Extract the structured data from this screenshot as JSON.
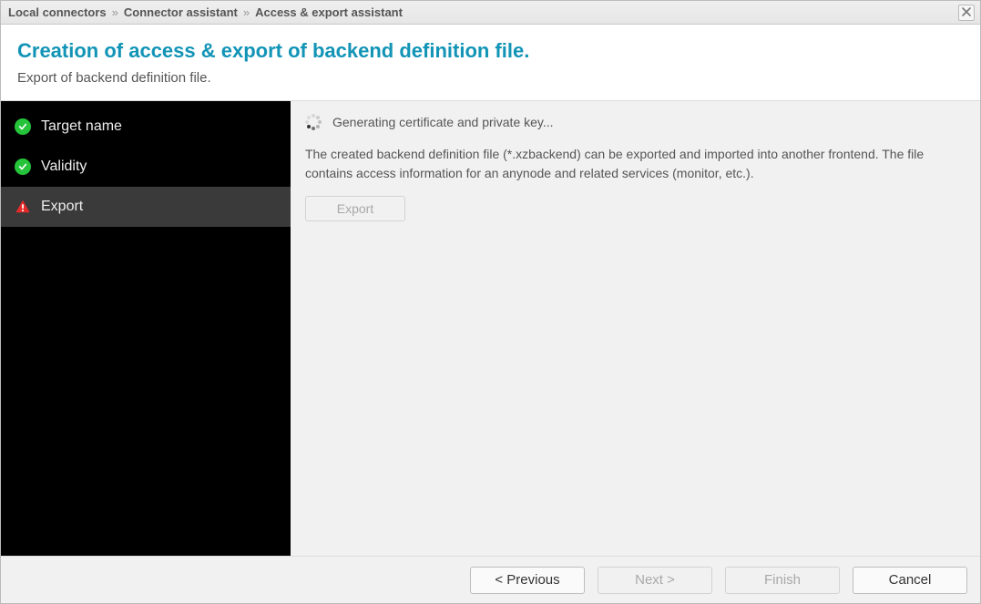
{
  "titlebar": {
    "crumbs": [
      "Local connectors",
      "Connector assistant",
      "Access & export assistant"
    ],
    "separator": "»",
    "close_aria": "Close"
  },
  "header": {
    "title": "Creation of access & export of backend definition file.",
    "subtitle": "Export of backend definition file."
  },
  "sidebar": {
    "steps": [
      {
        "label": "Target name",
        "state": "done"
      },
      {
        "label": "Validity",
        "state": "done"
      },
      {
        "label": "Export",
        "state": "warn",
        "active": true
      }
    ]
  },
  "main": {
    "status_message": "Generating certificate and private key...",
    "description": "The created backend definition file (*.xzbackend) can be exported and imported into another frontend. The file contains access information for an anynode and related services (monitor, etc.).",
    "export_button": {
      "label": "Export",
      "enabled": false
    }
  },
  "footer": {
    "previous": {
      "label": "< Previous",
      "enabled": true
    },
    "next": {
      "label": "Next >",
      "enabled": false
    },
    "finish": {
      "label": "Finish",
      "enabled": false
    },
    "cancel": {
      "label": "Cancel",
      "enabled": true
    }
  }
}
